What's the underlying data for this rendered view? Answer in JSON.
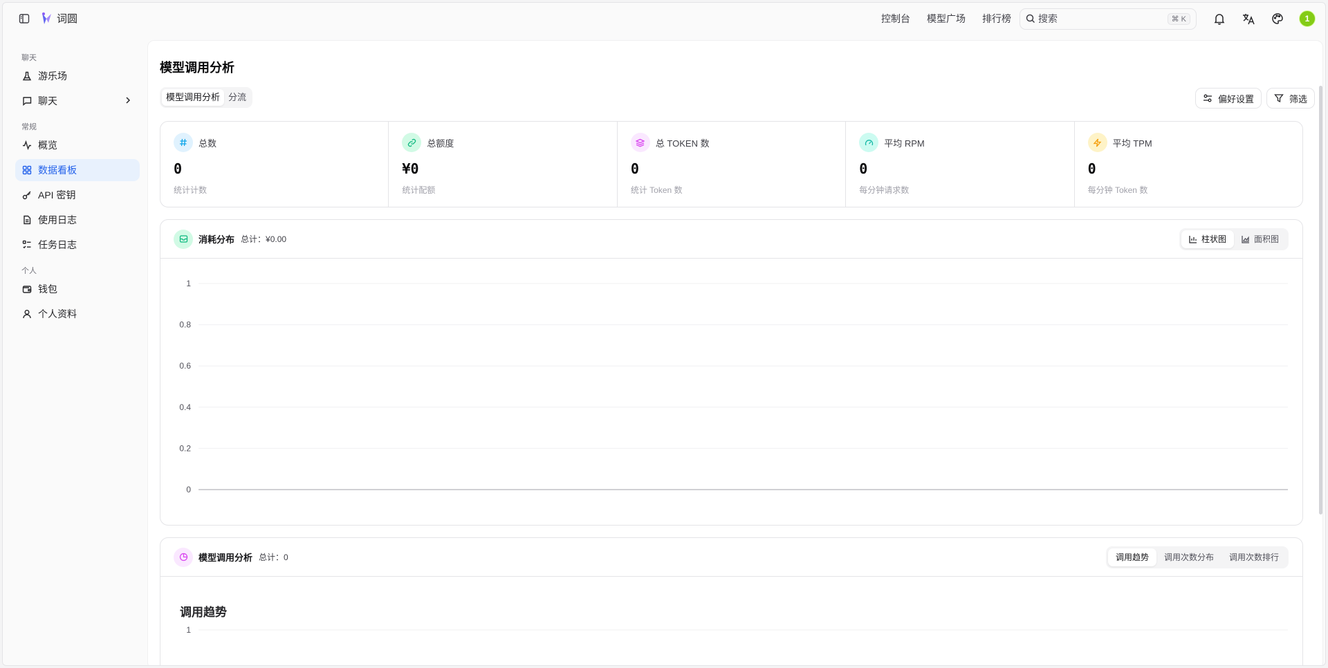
{
  "app": {
    "name": "词圆"
  },
  "topnav": {
    "links": [
      "控制台",
      "模型广场",
      "排行榜"
    ],
    "search_placeholder": "搜索",
    "search_shortcut": "⌘ K",
    "avatar_initial": "1"
  },
  "sidebar": {
    "sections": [
      {
        "title": "聊天",
        "items": [
          {
            "label": "游乐场",
            "icon": "flask-icon"
          },
          {
            "label": "聊天",
            "icon": "chat-icon",
            "has_submenu": true
          }
        ]
      },
      {
        "title": "常规",
        "items": [
          {
            "label": "概览",
            "icon": "activity-icon"
          },
          {
            "label": "数据看板",
            "icon": "dashboard-icon",
            "active": true
          },
          {
            "label": "API 密钥",
            "icon": "key-icon"
          },
          {
            "label": "使用日志",
            "icon": "file-icon"
          },
          {
            "label": "任务日志",
            "icon": "list-check-icon"
          }
        ]
      },
      {
        "title": "个人",
        "items": [
          {
            "label": "钱包",
            "icon": "wallet-icon"
          },
          {
            "label": "个人资料",
            "icon": "user-icon"
          }
        ]
      }
    ]
  },
  "page": {
    "title": "模型调用分析",
    "tabs": [
      {
        "label": "模型调用分析",
        "active": true
      },
      {
        "label": "分流",
        "active": false
      }
    ],
    "actions": {
      "preferences": "偏好设置",
      "filter": "筛选"
    }
  },
  "stats": [
    {
      "label": "总数",
      "value": "0",
      "sub": "统计计数",
      "icon": "hash-icon",
      "color": "#0ea5e9",
      "bg": "#e0f2fe"
    },
    {
      "label": "总额度",
      "value": "¥0",
      "sub": "统计配额",
      "icon": "link-icon",
      "color": "#10b981",
      "bg": "#d1fae5"
    },
    {
      "label": "总 TOKEN 数",
      "value": "0",
      "sub": "统计 Token 数",
      "icon": "layers-icon",
      "color": "#d946ef",
      "bg": "#fae8ff"
    },
    {
      "label": "平均 RPM",
      "value": "0",
      "sub": "每分钟请求数",
      "icon": "gauge-icon",
      "color": "#14b8a6",
      "bg": "#ccfbf1"
    },
    {
      "label": "平均 TPM",
      "value": "0",
      "sub": "每分钟 Token 数",
      "icon": "zap-icon",
      "color": "#f59e0b",
      "bg": "#fef3c7"
    }
  ],
  "consumption": {
    "title": "消耗分布",
    "total_label": "总计：",
    "total_value": "¥0.00",
    "views": [
      {
        "label": "柱状图",
        "active": true
      },
      {
        "label": "面积图",
        "active": false
      }
    ]
  },
  "model_analysis": {
    "title": "模型调用分析",
    "total_label": "总计：",
    "total_value": "0",
    "views": [
      {
        "label": "调用趋势",
        "active": true
      },
      {
        "label": "调用次数分布",
        "active": false
      },
      {
        "label": "调用次数排行",
        "active": false
      }
    ],
    "subtitle": "调用趋势"
  },
  "chart_data": [
    {
      "type": "bar",
      "title": "",
      "categories": [],
      "values": [],
      "ylim": [
        0,
        1
      ],
      "yticks": [
        "1",
        "0.8",
        "0.6",
        "0.4",
        "0.2",
        "0"
      ],
      "grid": true
    },
    {
      "type": "line",
      "title": "调用趋势",
      "x": [],
      "values": [],
      "yticks": [
        "1"
      ],
      "grid": true
    }
  ]
}
